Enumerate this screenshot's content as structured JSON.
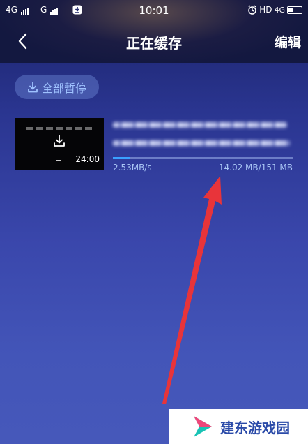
{
  "status_bar": {
    "sim1": "4G",
    "sim2": "G",
    "time": "10:01",
    "hd": "HD",
    "net_right": "4G"
  },
  "nav": {
    "title": "正在缓存",
    "edit_label": "编辑"
  },
  "actions": {
    "pause_all_label": "全部暂停"
  },
  "downloads": [
    {
      "duration": "24:00",
      "speed": "2.53MB/s",
      "size": "14.02 MB/151 MB",
      "progress": 0.093
    }
  ],
  "watermark": {
    "text": "建东游戏园"
  },
  "colors": {
    "accent": "#3aa0ff",
    "annotation_arrow": "#e8343a",
    "watermark_text": "#2a4aa8"
  }
}
